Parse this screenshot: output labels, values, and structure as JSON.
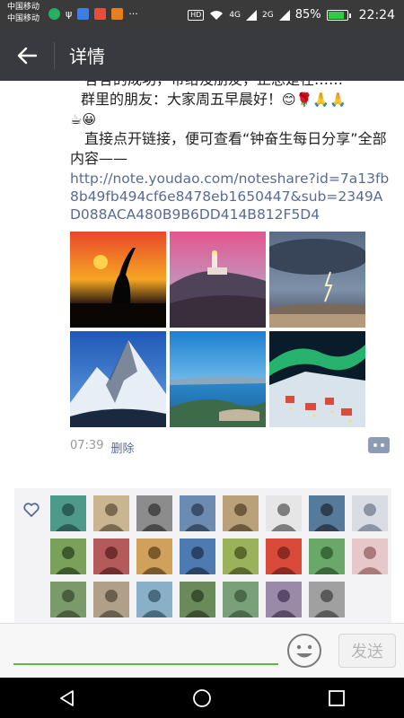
{
  "status_bar": {
    "carrier_1": "中国移动",
    "carrier_2": "中国移动",
    "hd": "HD",
    "signal_1": "4G",
    "signal_2": "2G",
    "battery_pct": "85%",
    "battery_level": 0.85,
    "time": "22:24"
  },
  "header": {
    "title": "详情"
  },
  "post": {
    "line_cut": "各各的成功，带给没朋友，正总是在……",
    "greeting_prefix": "群里的朋友：大家周五早晨好！",
    "greeting_emojis": "😊🌹🙏🙏",
    "line_emojis": "☕😀",
    "body": "直接点开链接，便可查看“钟奋生每日分享”全部内容——",
    "link": "http://note.youdao.com/noteshare?id=7a13fb8b49fb494cf6e8478eb1650447&sub=2349AD088ACA480B9B6DD414B812F5D4",
    "time": "07:39",
    "delete_label": "删除",
    "photos": [
      "sunset-heron",
      "lighthouse",
      "lightning-storm",
      "snow-mountain",
      "lake-town",
      "aurora-village"
    ]
  },
  "likes": {
    "avatars": [
      "av1",
      "av2",
      "av3",
      "av4",
      "av5",
      "av6",
      "av7",
      "av8",
      "av9",
      "av10",
      "av11",
      "av12",
      "av13",
      "av14",
      "av15",
      "av16",
      "av17",
      "av18",
      "av19",
      "av20",
      "av21",
      "av22",
      "av23"
    ]
  },
  "input": {
    "placeholder": "",
    "value": "",
    "send_label": "发送"
  },
  "colors": {
    "title_bar": "#393a3f",
    "link": "#576b95",
    "accent": "#5bb845"
  }
}
